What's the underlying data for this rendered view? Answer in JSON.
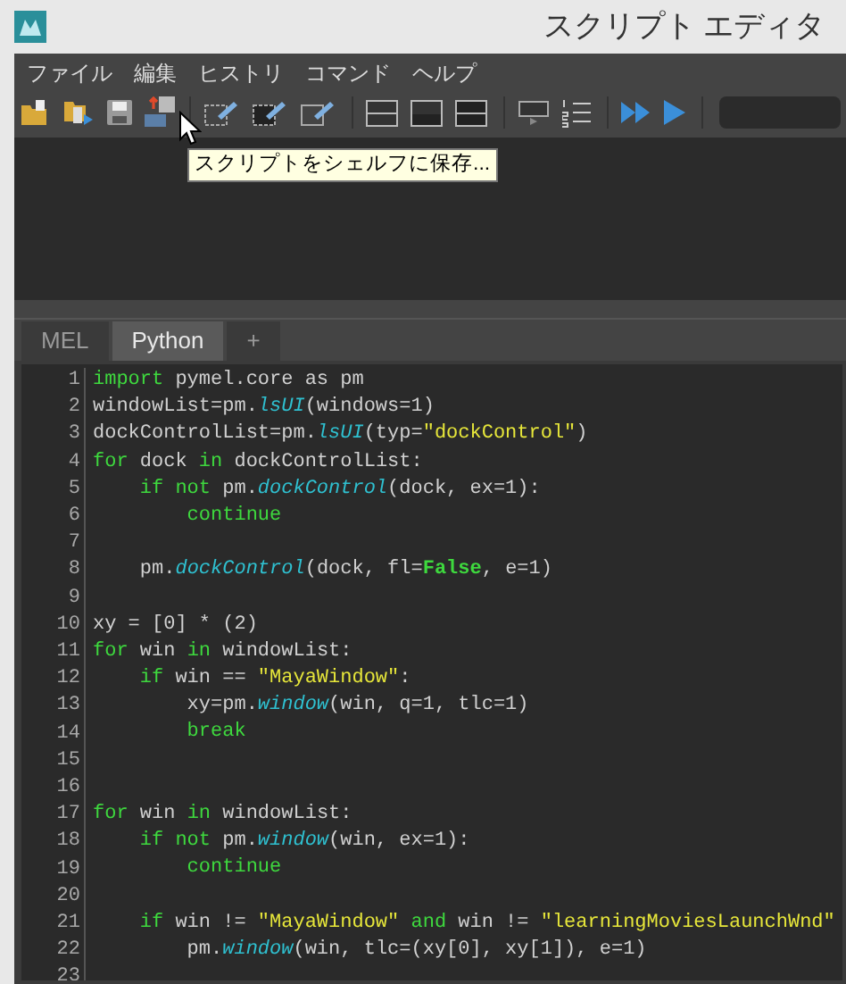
{
  "window": {
    "title": "スクリプト エディタ"
  },
  "menu": [
    "ファイル",
    "編集",
    "ヒストリ",
    "コマンド",
    "ヘルプ"
  ],
  "tooltip": "スクリプトをシェルフに保存...",
  "tabs": [
    {
      "label": "MEL",
      "selected": false
    },
    {
      "label": "Python",
      "selected": true
    },
    {
      "label": "+",
      "selected": false
    }
  ],
  "code": [
    {
      "number": "1",
      "tokens": [
        {
          "kind": "kw",
          "text": "import"
        },
        {
          "kind": "plain",
          "text": " pymel.core as pm"
        }
      ]
    },
    {
      "number": "2",
      "tokens": [
        {
          "kind": "plain",
          "text": "windowList=pm."
        },
        {
          "kind": "fn",
          "text": "lsUI"
        },
        {
          "kind": "plain",
          "text": "(windows=1)"
        }
      ]
    },
    {
      "number": "3",
      "tokens": [
        {
          "kind": "plain",
          "text": "dockControlList=pm."
        },
        {
          "kind": "fn",
          "text": "lsUI"
        },
        {
          "kind": "plain",
          "text": "(typ="
        },
        {
          "kind": "str",
          "text": "\"dockControl\""
        },
        {
          "kind": "plain",
          "text": ")"
        }
      ]
    },
    {
      "number": "4",
      "tokens": [
        {
          "kind": "kw",
          "text": "for"
        },
        {
          "kind": "plain",
          "text": " dock "
        },
        {
          "kind": "kw",
          "text": "in"
        },
        {
          "kind": "plain",
          "text": " dockControlList:"
        }
      ]
    },
    {
      "number": "5",
      "tokens": [
        {
          "kind": "kw",
          "text": "    if not"
        },
        {
          "kind": "plain",
          "text": " pm."
        },
        {
          "kind": "fn",
          "text": "dockControl"
        },
        {
          "kind": "plain",
          "text": "(dock, ex=1):"
        }
      ]
    },
    {
      "number": "6",
      "tokens": [
        {
          "kind": "kw",
          "text": "        continue"
        }
      ]
    },
    {
      "number": "7"
    },
    {
      "number": "8",
      "tokens": [
        {
          "kind": "plain",
          "text": "    pm."
        },
        {
          "kind": "fn",
          "text": "dockControl"
        },
        {
          "kind": "plain",
          "text": "(dock, fl="
        },
        {
          "kind": "const",
          "text": "False"
        },
        {
          "kind": "plain",
          "text": ", e=1)"
        }
      ]
    },
    {
      "number": "9"
    },
    {
      "number": "10",
      "tokens": [
        {
          "kind": "plain",
          "text": "xy = [0] * (2)"
        }
      ]
    },
    {
      "number": "11",
      "tokens": [
        {
          "kind": "kw",
          "text": "for"
        },
        {
          "kind": "plain",
          "text": " win "
        },
        {
          "kind": "kw",
          "text": "in"
        },
        {
          "kind": "plain",
          "text": " windowList:"
        }
      ]
    },
    {
      "number": "12",
      "tokens": [
        {
          "kind": "kw",
          "text": "    if"
        },
        {
          "kind": "plain",
          "text": " win == "
        },
        {
          "kind": "str",
          "text": "\"MayaWindow\""
        },
        {
          "kind": "plain",
          "text": ":"
        }
      ]
    },
    {
      "number": "13",
      "tokens": [
        {
          "kind": "plain",
          "text": "        xy=pm."
        },
        {
          "kind": "fn",
          "text": "window"
        },
        {
          "kind": "plain",
          "text": "(win, q=1, tlc=1)"
        }
      ]
    },
    {
      "number": "14",
      "tokens": [
        {
          "kind": "kw",
          "text": "        break"
        }
      ]
    },
    {
      "number": "15"
    },
    {
      "number": "16"
    },
    {
      "number": "17",
      "tokens": [
        {
          "kind": "kw",
          "text": "for"
        },
        {
          "kind": "plain",
          "text": " win "
        },
        {
          "kind": "kw",
          "text": "in"
        },
        {
          "kind": "plain",
          "text": " windowList:"
        }
      ]
    },
    {
      "number": "18",
      "tokens": [
        {
          "kind": "kw",
          "text": "    if not"
        },
        {
          "kind": "plain",
          "text": " pm."
        },
        {
          "kind": "fn",
          "text": "window"
        },
        {
          "kind": "plain",
          "text": "(win, ex=1):"
        }
      ]
    },
    {
      "number": "19",
      "tokens": [
        {
          "kind": "kw",
          "text": "        continue"
        }
      ]
    },
    {
      "number": "20"
    },
    {
      "number": "21",
      "tokens": [
        {
          "kind": "kw",
          "text": "    if"
        },
        {
          "kind": "plain",
          "text": " win != "
        },
        {
          "kind": "str",
          "text": "\"MayaWindow\""
        },
        {
          "kind": "kw",
          "text": " and"
        },
        {
          "kind": "plain",
          "text": " win != "
        },
        {
          "kind": "str",
          "text": "\"learningMoviesLaunchWnd\""
        }
      ]
    },
    {
      "number": "22",
      "tokens": [
        {
          "kind": "plain",
          "text": "        pm."
        },
        {
          "kind": "fn",
          "text": "window"
        },
        {
          "kind": "plain",
          "text": "(win, tlc=(xy[0], xy[1]), e=1)"
        }
      ]
    },
    {
      "number": "23"
    }
  ]
}
